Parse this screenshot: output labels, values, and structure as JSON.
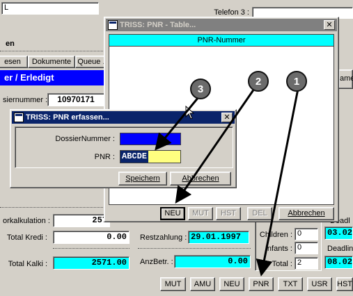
{
  "background": {
    "top_partial_label": "L",
    "telefon_label": "Telefon 3 :",
    "section_partial": "en",
    "tabs": [
      "esen",
      "Dokumente",
      "Queue ..."
    ],
    "status_bar": "er / Erledigt",
    "dossier_label": "siernummer :",
    "dossier_value": "10970171",
    "right_partial_label": "ame",
    "vorkalkulation_label": "orkalkulation :",
    "vorkalkulation_value": "257",
    "total_kredi_label": "Total Kredi :",
    "total_kredi_value": "0.00",
    "total_kalki_label": "Total Kalki :",
    "total_kalki_value": "2571.00",
    "restzahlung_label": "Restzahlung :",
    "restzahlung_value": "29.01.1997",
    "anzbetr_label": "AnzBetr. :",
    "anzbetr_value": "0.00",
    "children_label": "Children :",
    "children_value": "0",
    "infants_label": "Infants :",
    "infants_value": "0",
    "total_label": "Total :",
    "total_value": "2",
    "deadline1_label": "Deadl",
    "deadline1_value": "03.02",
    "deadline2_label": "Deadlin",
    "deadline2_value": "08.02",
    "bottom_buttons": [
      "MUT",
      "AMU",
      "NEU",
      "PNR",
      "TXT",
      "USR",
      "HST"
    ]
  },
  "table_window": {
    "title": "TRISS: PNR - Table...",
    "column_header": "PNR-Nummer",
    "buttons": {
      "neu": "NEU",
      "mut": "MUT",
      "hst": "HST",
      "del": "DEL",
      "abbrechen": "Abbrechen"
    }
  },
  "pnr_dialog": {
    "title": "TRISS: PNR erfassen...",
    "dossier_label": "DossierNummer :",
    "dossier_value": "",
    "pnr_label": "PNR :",
    "pnr_value": "ABCDE",
    "save_button": "Speichern",
    "cancel_button": "Abbrechen"
  },
  "callouts": [
    "1",
    "2",
    "3"
  ],
  "colors": {
    "titlebar_active": "#0a246a",
    "titlebar_inactive": "#808080",
    "highlight_cyan": "#00ffff",
    "field_blue": "#0000ff",
    "field_yellow": "#ffff80",
    "window_face": "#d4d0c8"
  }
}
